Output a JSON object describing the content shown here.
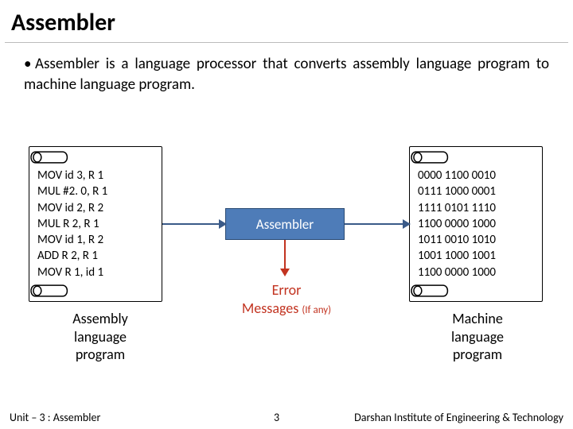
{
  "title": "Assembler",
  "bullet": "Assembler is a language processor that converts assembly language program to machine language program.",
  "assembly": [
    "MOV id 3, R 1",
    "MUL #2. 0, R 1",
    "MOV id 2, R 2",
    "MUL R 2, R 1",
    "MOV id 1, R 2",
    "ADD R 2, R 1",
    "MOV R 1, id 1"
  ],
  "machine": [
    "0000 1100 0010",
    "0111 1000 0001",
    "1111 0101 1110",
    "1100 0000 1000",
    "1011 0010 1010",
    "1001 1000 1001",
    "1100 0000 1000"
  ],
  "assembler_label": "Assembler",
  "error": {
    "line1": "Error",
    "line2": "Messages",
    "ifany": "(If any)"
  },
  "captions": {
    "left": [
      "Assembly",
      "language",
      "program"
    ],
    "right": [
      "Machine",
      "language",
      "program"
    ]
  },
  "footer": {
    "unit": "Unit – 3 : Assembler",
    "page": "3",
    "institute": "Darshan Institute of Engineering & Technology"
  }
}
